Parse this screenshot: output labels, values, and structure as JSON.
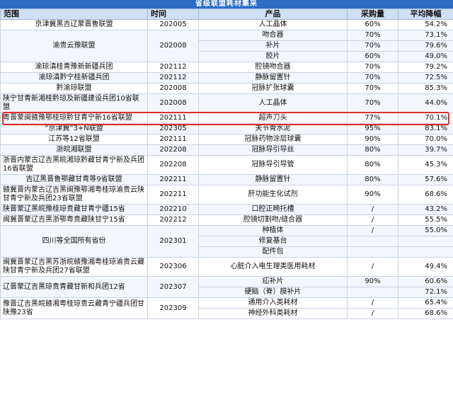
{
  "title": "省级联盟耗材集采",
  "headers": {
    "alliance": "范围",
    "time": "时间",
    "product": "产品",
    "purchase": "采购量",
    "decline": "平均降幅"
  },
  "rows": [
    {
      "alliance": "京津冀黑吉辽蒙晋鲁联盟",
      "time": "202005",
      "items": [
        {
          "product": "人工晶体",
          "purchase": "60%",
          "decline": "54.2%"
        }
      ]
    },
    {
      "alliance": "渝贵云豫联盟",
      "time": "202008",
      "items": [
        {
          "product": "吻合器",
          "purchase": "70%",
          "decline": "73.1%"
        },
        {
          "product": "补片",
          "purchase": "70%",
          "decline": "79.6%"
        },
        {
          "product": "胶片",
          "purchase": "60%",
          "decline": "49.0%"
        }
      ]
    },
    {
      "alliance": "渝琼滇桂青豫新新疆兵团",
      "time": "202112",
      "items": [
        {
          "product": "腔镜吻合器",
          "purchase": "70%",
          "decline": "79.2%"
        }
      ]
    },
    {
      "alliance": "渝琼滇黔宁桂新疆兵团",
      "time": "202112",
      "items": [
        {
          "product": "静脉留置针",
          "purchase": "70%",
          "decline": "72.5%"
        }
      ]
    },
    {
      "alliance": "黔渝琼联盟",
      "time": "202008",
      "items": [
        {
          "product": "冠脉扩张球囊",
          "purchase": "70%",
          "decline": "85.3%"
        }
      ]
    },
    {
      "alliance": "陕宁甘青新湘桂黔琼及新疆建设兵团10省联盟",
      "time": "202008",
      "items": [
        {
          "product": "人工晶体",
          "purchase": "70%",
          "decline": "44.0%"
        }
      ]
    },
    {
      "alliance": "粤晋蒙闽赣豫鄂桂琼黔甘青宁新16省联盟",
      "time": "202111",
      "items": [
        {
          "product": "超声刀头",
          "purchase": "77%",
          "decline": "70.1%"
        }
      ],
      "highlight": true
    },
    {
      "alliance": "“京津冀”3+N联盟",
      "time": "202305",
      "items": [
        {
          "product": "关节骨水泥",
          "purchase": "95%",
          "decline": "83.1%"
        }
      ]
    },
    {
      "alliance": "江苏等12省联盟",
      "time": "202111",
      "items": [
        {
          "product": "冠脉药物涂层球囊",
          "purchase": "90%",
          "decline": "70.0%"
        }
      ]
    },
    {
      "alliance": "浙皖湘联盟",
      "time": "202208",
      "items": [
        {
          "product": "冠脉导引导丝",
          "purchase": "80%",
          "decline": "39.7%"
        }
      ]
    },
    {
      "alliance": "浙晋内蒙古辽吉黑皖湘琼黔藏甘青宁新及兵团16省联盟",
      "time": "202208",
      "items": [
        {
          "product": "冠脉导引导管",
          "purchase": "80%",
          "decline": "45.3%"
        }
      ]
    },
    {
      "alliance": "吉辽黑晋鲁鄂藏甘青等9省联盟",
      "time": "202211",
      "items": [
        {
          "product": "静脉留置针",
          "purchase": "80%",
          "decline": "57.6%"
        }
      ]
    },
    {
      "alliance": "赣冀晋内蒙古辽吉黑闽豫鄂湘粤桂琼渝贵云陕甘青宁新及兵团23省联盟",
      "time": "202211",
      "items": [
        {
          "product": "肝功能生化试剂",
          "purchase": "90%",
          "decline": "68.6%"
        }
      ]
    },
    {
      "alliance": "陕晋蒙辽黑皖豫桂琼贵藏甘青宁疆15省",
      "time": "202210",
      "items": [
        {
          "product": "口腔正畸托槽",
          "purchase": "/",
          "decline": "43.2%"
        }
      ]
    },
    {
      "alliance": "闽冀晋蒙辽吉黑浙鄂粤贵藏陕甘宁15省",
      "time": "202212",
      "items": [
        {
          "product": "腔镜切割吻/缝合器",
          "purchase": "/",
          "decline": "55.5%"
        }
      ]
    },
    {
      "alliance": "四川等全国所有省份",
      "time": "202301",
      "items": [
        {
          "product": "种植体",
          "purchase": "/",
          "decline": "55.0%"
        },
        {
          "product": "修复基台",
          "purchase": "",
          "decline": ""
        },
        {
          "product": "配件包",
          "purchase": "",
          "decline": ""
        }
      ]
    },
    {
      "alliance": "闽冀晋蒙辽吉黑苏浙皖赣豫湘粤桂琼渝贵云藏陕甘青宁新及兵团27省联盟",
      "time": "202306",
      "items": [
        {
          "product": "心脏介入电生理类医用耗材",
          "purchase": "/",
          "decline": "49.4%"
        }
      ]
    },
    {
      "alliance": "辽晋蒙辽吉黑琼贵青藏甘新和兵团12省",
      "time": "202307",
      "items": [
        {
          "product": "疝补片",
          "purchase": "90%",
          "decline": "60.6%"
        },
        {
          "product": "硬脑（脊）膜补片",
          "purchase": "",
          "decline": "72.1%"
        }
      ]
    },
    {
      "alliance": "豫晋辽吉黑皖赣湘粤桂琼贵云藏青宁疆兵团甘陕豫23省",
      "time": "202309",
      "items": [
        {
          "product": "通用介入类耗材",
          "purchase": "/",
          "decline": "65.4%"
        },
        {
          "product": "神经外科类耗材",
          "purchase": "/",
          "decline": "68.6%"
        }
      ]
    }
  ]
}
